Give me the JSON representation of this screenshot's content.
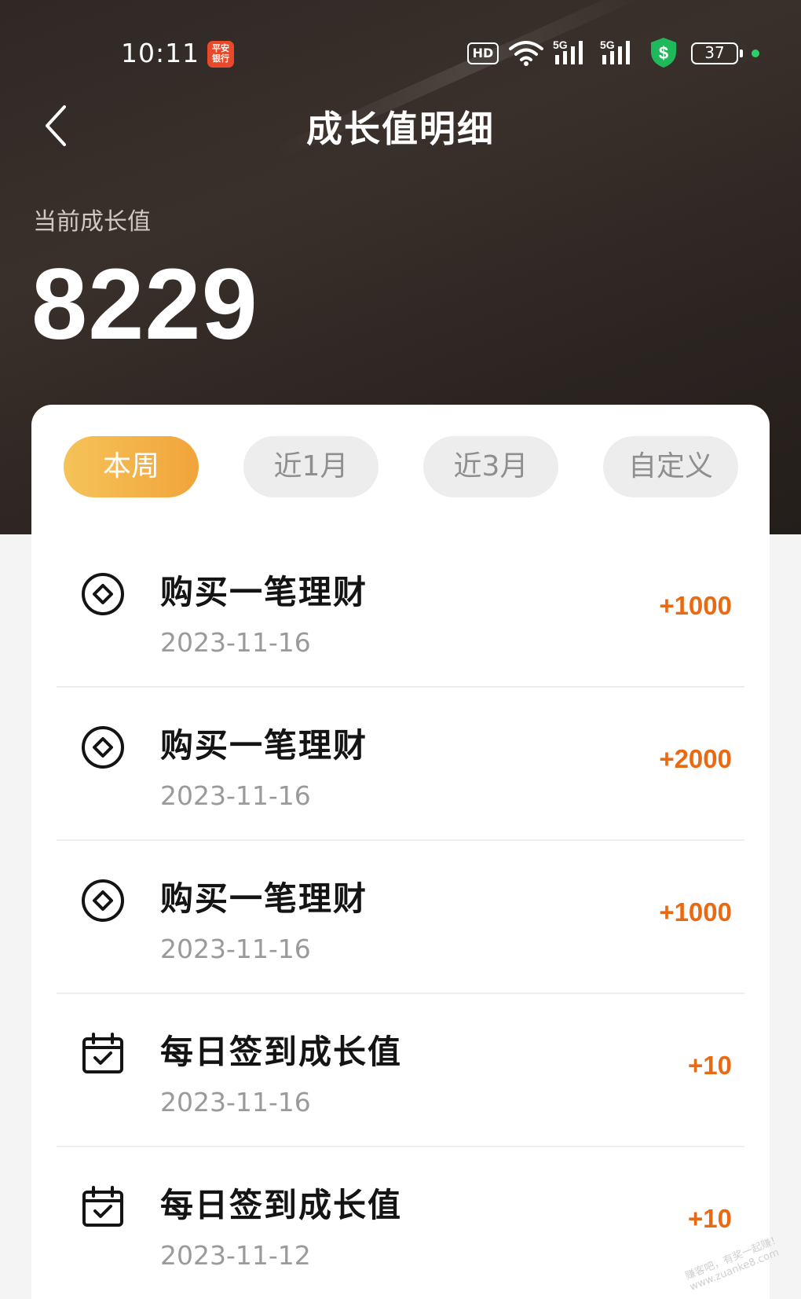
{
  "status_bar": {
    "time": "10:11",
    "app_badge": "平安\n银行",
    "hd_label": "HD",
    "signal_label_1": "5G",
    "signal_label_2": "5G",
    "battery": "37"
  },
  "header": {
    "title": "成长值明细",
    "back_icon": "chevron-left-icon"
  },
  "summary": {
    "label": "当前成长值",
    "value": "8229"
  },
  "tabs": [
    {
      "label": "本周",
      "active": true
    },
    {
      "label": "近1月",
      "active": false
    },
    {
      "label": "近3月",
      "active": false
    },
    {
      "label": "自定义",
      "active": false
    }
  ],
  "records": [
    {
      "icon": "coin-icon",
      "title": "购买一笔理财",
      "date": "2023-11-16",
      "amount": "+1000"
    },
    {
      "icon": "coin-icon",
      "title": "购买一笔理财",
      "date": "2023-11-16",
      "amount": "+2000"
    },
    {
      "icon": "coin-icon",
      "title": "购买一笔理财",
      "date": "2023-11-16",
      "amount": "+1000"
    },
    {
      "icon": "calendar-check-icon",
      "title": "每日签到成长值",
      "date": "2023-11-16",
      "amount": "+10"
    },
    {
      "icon": "calendar-check-icon",
      "title": "每日签到成长值",
      "date": "2023-11-12",
      "amount": "+10"
    }
  ],
  "colors": {
    "accent_orange": "#ea6a14",
    "tab_active_start": "#f5c359",
    "tab_active_end": "#f1a43a",
    "hero_bg": "#2f2825"
  },
  "watermark": "赚客吧，有奖一起赚！ www.zuanke8.com"
}
